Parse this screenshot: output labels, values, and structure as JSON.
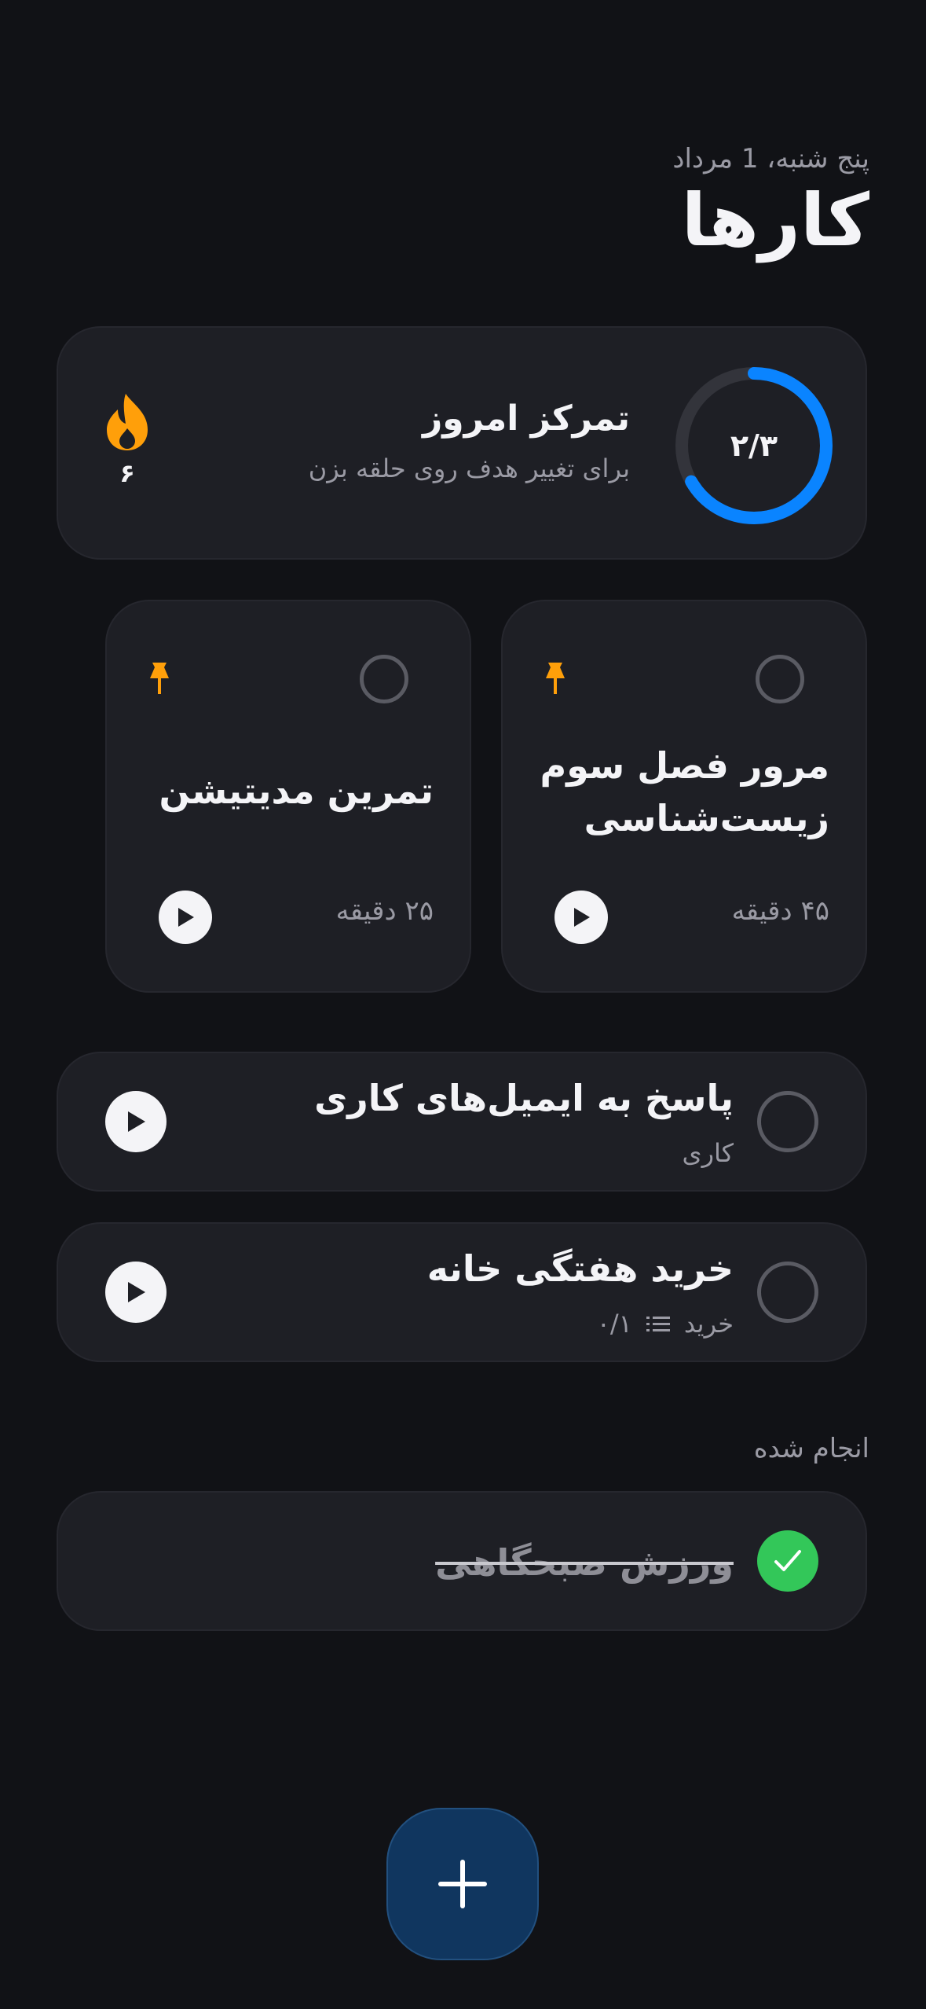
{
  "header": {
    "date": "پنج شنبه، 1 مرداد",
    "title": "کارها"
  },
  "focus": {
    "progress_label": "۲/۳",
    "progress_fraction": 0.667,
    "title": "تمرکز امروز",
    "subtitle": "برای تغییر هدف روی حلقه بزن",
    "streak": "۶",
    "ring_color": "#0a84ff",
    "flame_color": "#ff9f0a"
  },
  "pinned_tasks": [
    {
      "title_line1": "مرور فصل سوم",
      "title_line2": "زیست‌شناسی",
      "duration": "۴۵ دقیقه"
    },
    {
      "title_line1": "تمرین مدیتیشن",
      "title_line2": "",
      "duration": "۲۵ دقیقه"
    }
  ],
  "tasks": [
    {
      "title": "پاسخ به ایمیل‌های کاری",
      "category": "کاری",
      "subtasks": ""
    },
    {
      "title": "خرید هفتگی خانه",
      "category": "خرید",
      "subtasks": "۰/۱"
    }
  ],
  "done": {
    "header": "انجام شده",
    "items": [
      {
        "title": "ورزش صبحگاهی"
      }
    ]
  },
  "colors": {
    "done_green": "#33c759",
    "fab_bg": "#10365f"
  }
}
